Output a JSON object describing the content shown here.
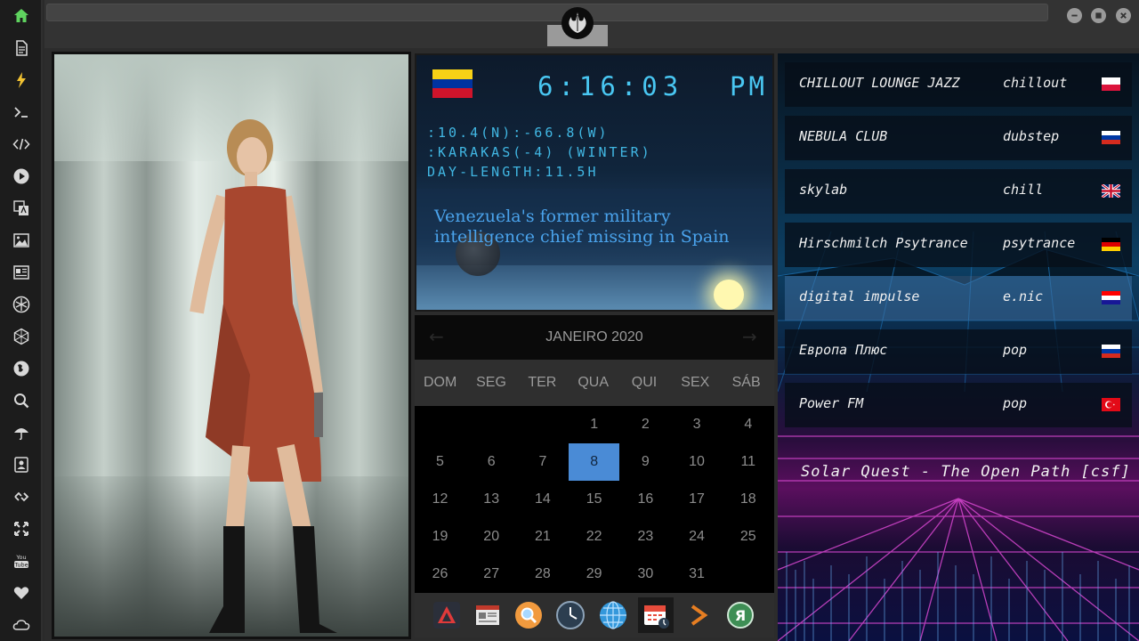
{
  "sidebar": {
    "items": [
      {
        "icon": "home-icon",
        "color": "#5fd35f"
      },
      {
        "icon": "document-icon"
      },
      {
        "icon": "lightning-icon",
        "color": "#f1c232"
      },
      {
        "icon": "terminal-icon"
      },
      {
        "icon": "code-icon"
      },
      {
        "icon": "play-icon"
      },
      {
        "icon": "translate-icon"
      },
      {
        "icon": "image-icon"
      },
      {
        "icon": "news-icon"
      },
      {
        "icon": "rebel-icon"
      },
      {
        "icon": "hexagon-icon"
      },
      {
        "icon": "globe-icon"
      },
      {
        "icon": "search-icon"
      },
      {
        "icon": "umbrella-icon"
      },
      {
        "icon": "contacts-icon"
      },
      {
        "icon": "link-icon"
      },
      {
        "icon": "expand-icon"
      },
      {
        "icon": "youtube-icon",
        "label": "You Tube"
      },
      {
        "icon": "heart-icon"
      },
      {
        "icon": "cloud-icon"
      }
    ]
  },
  "topbar": {
    "emblem": "rebel-alliance-emblem",
    "window_buttons": [
      "minimize-icon",
      "maximize-icon",
      "close-icon"
    ]
  },
  "clock": {
    "time": "6:16:03",
    "ampm": "PM",
    "coords": ":10.4(N):-66.8(W)",
    "timezone": ":KARAKAS(-4) (WINTER)",
    "day_length": "DAY-LENGTH:11.5H",
    "flag": [
      "#f7d116",
      "#0033a0",
      "#cf142b"
    ],
    "news": "Venezuela's former military intelligence chief missing in Spain"
  },
  "calendar": {
    "month": "JANEIRO 2020",
    "weekdays": [
      "DOM",
      "SEG",
      "TER",
      "QUA",
      "QUI",
      "SEX",
      "SÁB"
    ],
    "first_weekday": 3,
    "days_in_month": 31,
    "selected_day": 8
  },
  "dock": {
    "items": [
      "archive-app-icon",
      "news-app-icon",
      "search-app-icon",
      "clock-app-icon",
      "globe-app-icon",
      "calendar-app-icon",
      "forward-app-icon",
      "yandex-app-icon"
    ]
  },
  "radio": {
    "stations": [
      {
        "name": "CHILLOUT LOUNGE JAZZ",
        "genre": "chillout",
        "flag": [
          "#ffffff",
          "#dc143c"
        ]
      },
      {
        "name": "NEBULA CLUB",
        "genre": "dubstep",
        "flag": [
          "#ffffff",
          "#0039a6",
          "#d52b1e"
        ]
      },
      {
        "name": "skylab",
        "genre": "chill",
        "flag": [
          "#012169",
          "#c8102e",
          "#ffffff"
        ]
      },
      {
        "name": "Hirschmilch Psytrance",
        "genre": "psytrance",
        "flag": [
          "#000000",
          "#dd0000",
          "#ffce00"
        ]
      },
      {
        "name": "digital impulse",
        "genre": "e.nic",
        "flag": [
          "#ff0000",
          "#ffffff",
          "#171796"
        ]
      },
      {
        "name": "Европа Плюс",
        "genre": "pop",
        "flag": [
          "#ffffff",
          "#0039a6",
          "#d52b1e"
        ]
      },
      {
        "name": "Power FM",
        "genre": "pop",
        "flag": [
          "#e30a17"
        ]
      }
    ],
    "now_playing": "Solar Quest - The Open Path [csf]"
  }
}
